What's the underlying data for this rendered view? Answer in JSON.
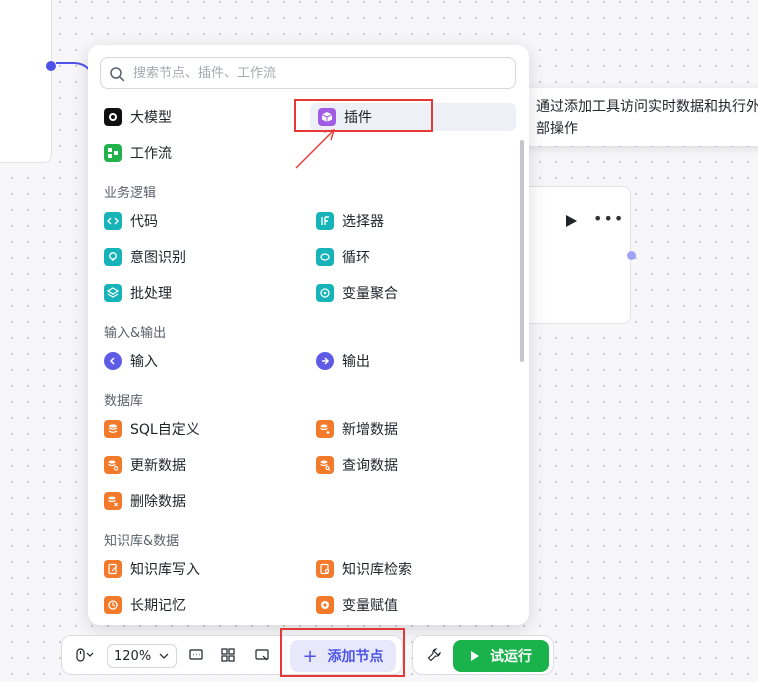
{
  "search": {
    "placeholder": "搜索节点、插件、工作流"
  },
  "top_items": [
    {
      "label": "大模型",
      "icon": "llm-icon",
      "color": "#111111"
    },
    {
      "label": "插件",
      "icon": "plugin-cube-icon",
      "color": "#a15ce6"
    },
    {
      "label": "工作流",
      "icon": "workflow-icon",
      "color": "#22b24c"
    }
  ],
  "sections": [
    {
      "title": "业务逻辑",
      "items": [
        {
          "label": "代码",
          "icon": "code-icon",
          "color": "#16b3b8"
        },
        {
          "label": "选择器",
          "icon": "if-selector-icon",
          "color": "#16b3b8"
        },
        {
          "label": "意图识别",
          "icon": "intent-icon",
          "color": "#16b3b8"
        },
        {
          "label": "循环",
          "icon": "loop-icon",
          "color": "#16b3b8"
        },
        {
          "label": "批处理",
          "icon": "batch-icon",
          "color": "#16b3b8"
        },
        {
          "label": "变量聚合",
          "icon": "variable-merge-icon",
          "color": "#16b3b8"
        }
      ]
    },
    {
      "title": "输入&输出",
      "items": [
        {
          "label": "输入",
          "icon": "input-icon",
          "color": "#5e5ce6"
        },
        {
          "label": "输出",
          "icon": "output-icon",
          "color": "#5e5ce6"
        }
      ]
    },
    {
      "title": "数据库",
      "items": [
        {
          "label": "SQL自定义",
          "icon": "database-sql-icon",
          "color": "#f27a2a"
        },
        {
          "label": "新增数据",
          "icon": "database-add-icon",
          "color": "#f27a2a"
        },
        {
          "label": "更新数据",
          "icon": "database-update-icon",
          "color": "#f27a2a"
        },
        {
          "label": "查询数据",
          "icon": "database-query-icon",
          "color": "#f27a2a"
        },
        {
          "label": "删除数据",
          "icon": "database-delete-icon",
          "color": "#f27a2a"
        }
      ]
    },
    {
      "title": "知识库&数据",
      "items": [
        {
          "label": "知识库写入",
          "icon": "knowledge-write-icon",
          "color": "#f27a2a"
        },
        {
          "label": "知识库检索",
          "icon": "knowledge-search-icon",
          "color": "#f27a2a"
        },
        {
          "label": "长期记忆",
          "icon": "memory-icon",
          "color": "#f27a2a"
        },
        {
          "label": "变量赋值",
          "icon": "variable-assign-icon",
          "color": "#f27a2a"
        }
      ]
    }
  ],
  "tooltip": {
    "text": "通过添加工具访问实时数据和执行外部操作"
  },
  "toolbar": {
    "zoom": "120%",
    "add_node_label": "添加节点",
    "run_label": "试运行"
  },
  "colors": {
    "accent": "#4d53e8",
    "run_green": "#19b24b",
    "annotation_red": "#e53935"
  }
}
